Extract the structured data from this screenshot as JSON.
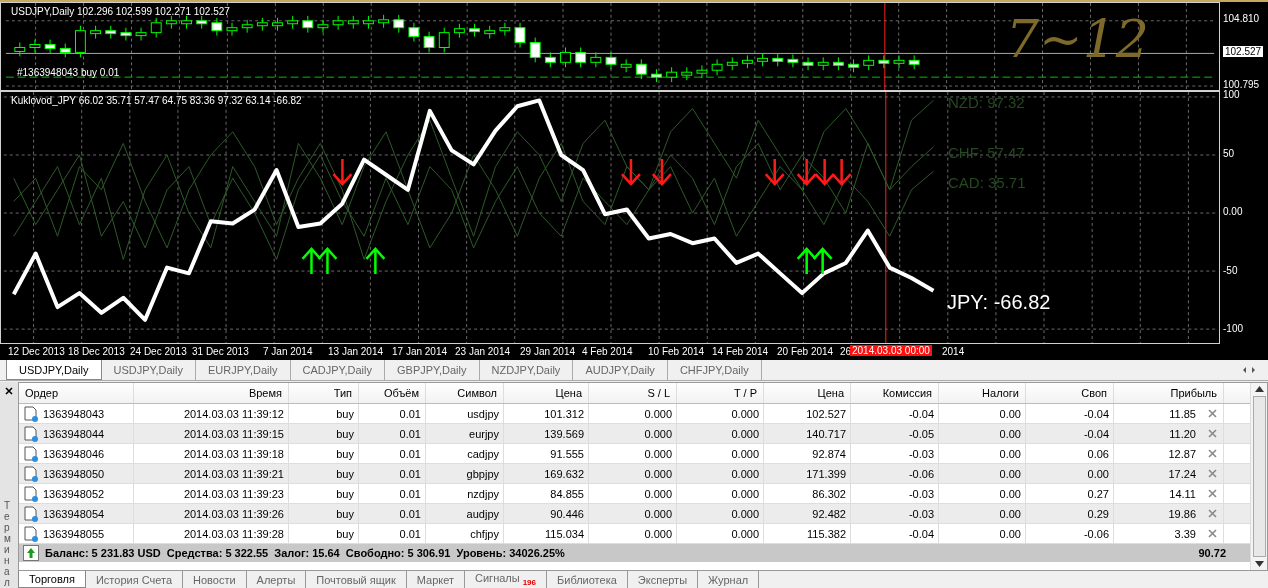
{
  "price_chart": {
    "header": "USDJPY,Daily  102.296 102.599 102.271 102.527",
    "order_line": "#1363948043 buy 0.01",
    "handwriting": "7~12",
    "axis": [
      {
        "label": "104.810",
        "kind": "tick"
      },
      {
        "label": "102.527",
        "kind": "current"
      },
      {
        "label": "100.795",
        "kind": "tick"
      }
    ]
  },
  "indicator": {
    "header": "Kuklovod_JPY 66.02 35.71 57.47 64.75 83.36 97.32 63.14 -66.82",
    "chart_data": {
      "type": "line",
      "grid": true,
      "ylim": [
        -100,
        100
      ],
      "yticks": [
        {
          "value": 100,
          "label": "100"
        },
        {
          "value": 50,
          "label": "50"
        },
        {
          "value": 0,
          "label": "0.00"
        },
        {
          "value": -50,
          "label": "-50"
        },
        {
          "value": -100,
          "label": "-100"
        }
      ],
      "series": [
        {
          "name": "NZD: 97.32",
          "color": "#2f5a2a",
          "values": [
            10,
            30,
            -20,
            40,
            20,
            60,
            10,
            -30,
            20,
            50,
            70,
            40,
            -10,
            30,
            60,
            20,
            -40,
            10,
            50,
            80,
            30,
            -20,
            40,
            70,
            50,
            10,
            60,
            80,
            40,
            20,
            70,
            90,
            60,
            30,
            80,
            50,
            20,
            70,
            90,
            60,
            20,
            80,
            97
          ]
        },
        {
          "name": "CHF: 57.47",
          "color": "#2f5a2a",
          "values": [
            -20,
            10,
            40,
            -10,
            30,
            -40,
            20,
            50,
            0,
            -30,
            40,
            10,
            -20,
            60,
            30,
            -10,
            40,
            70,
            20,
            -30,
            0,
            50,
            20,
            -20,
            30,
            60,
            10,
            -10,
            40,
            20,
            50,
            30,
            -10,
            40,
            60,
            20,
            50,
            30,
            0,
            60,
            20,
            40,
            57
          ]
        },
        {
          "name": "CAD: 35.71",
          "color": "#2f5a2a",
          "values": [
            30,
            -10,
            20,
            50,
            -20,
            10,
            -30,
            20,
            40,
            -10,
            30,
            0,
            -40,
            20,
            50,
            10,
            -20,
            30,
            -10,
            40,
            20,
            -30,
            10,
            40,
            0,
            -20,
            30,
            10,
            -10,
            20,
            40,
            0,
            30,
            -20,
            10,
            40,
            20,
            -10,
            30,
            10,
            -20,
            20,
            36
          ]
        },
        {
          "name": "JPY: -66.82",
          "color": "#ffffff",
          "values": [
            -70,
            -35,
            -81,
            -69,
            -86,
            -73,
            -92,
            -47,
            -52,
            -7,
            -9,
            3,
            37,
            -12,
            -9,
            8,
            46,
            33,
            20,
            88,
            54,
            42,
            71,
            92,
            97,
            50,
            37,
            -1,
            3,
            -22,
            -18,
            -26,
            -22,
            -43,
            -35,
            -52,
            -69,
            -52,
            -43,
            -15,
            -47,
            -56,
            -67
          ]
        }
      ]
    }
  },
  "time_axis": {
    "labels": [
      "12 Dec 2013",
      "18 Dec 2013",
      "24 Dec 2013",
      "31 Dec 2013",
      "7 Jan 2014",
      "13 Jan 2014",
      "17 Jan 2014",
      "23 Jan 2014",
      "29 Jan 2014",
      "4 Feb 2014",
      "10 Feb 2014",
      "14 Feb 2014",
      "20 Feb 2014",
      "26"
    ],
    "cursor": "2014.03.03 00:00",
    "after_cursor": "2014"
  },
  "chart_tabs": [
    {
      "label": "USDJPY,Daily",
      "selected": true
    },
    {
      "label": "USDJPY,Daily",
      "selected": false
    },
    {
      "label": "EURJPY,Daily",
      "selected": false
    },
    {
      "label": "CADJPY,Daily",
      "selected": false
    },
    {
      "label": "GBPJPY,Daily",
      "selected": false
    },
    {
      "label": "NZDJPY,Daily",
      "selected": false
    },
    {
      "label": "AUDJPY,Daily",
      "selected": false
    },
    {
      "label": "CHFJPY,Daily",
      "selected": false
    }
  ],
  "terminal": {
    "side_label": "Терминал",
    "columns": [
      "Ордер",
      "Время",
      "Тип",
      "Объём",
      "Символ",
      "Цена",
      "S / L",
      "T / P",
      "Цена",
      "Комиссия",
      "Налоги",
      "Своп",
      "Прибыль"
    ],
    "rows": [
      [
        "1363948043",
        "2014.03.03 11:39:12",
        "buy",
        "0.01",
        "usdjpy",
        "101.312",
        "0.000",
        "0.000",
        "102.527",
        "-0.04",
        "0.00",
        "-0.04",
        "11.85"
      ],
      [
        "1363948044",
        "2014.03.03 11:39:15",
        "buy",
        "0.01",
        "eurjpy",
        "139.569",
        "0.000",
        "0.000",
        "140.717",
        "-0.05",
        "0.00",
        "-0.04",
        "11.20"
      ],
      [
        "1363948046",
        "2014.03.03 11:39:18",
        "buy",
        "0.01",
        "cadjpy",
        "91.555",
        "0.000",
        "0.000",
        "92.874",
        "-0.03",
        "0.00",
        "0.06",
        "12.87"
      ],
      [
        "1363948050",
        "2014.03.03 11:39:21",
        "buy",
        "0.01",
        "gbpjpy",
        "169.632",
        "0.000",
        "0.000",
        "171.399",
        "-0.06",
        "0.00",
        "0.00",
        "17.24"
      ],
      [
        "1363948052",
        "2014.03.03 11:39:23",
        "buy",
        "0.01",
        "nzdjpy",
        "84.855",
        "0.000",
        "0.000",
        "86.302",
        "-0.03",
        "0.00",
        "0.27",
        "14.11"
      ],
      [
        "1363948054",
        "2014.03.03 11:39:26",
        "buy",
        "0.01",
        "audjpy",
        "90.446",
        "0.000",
        "0.000",
        "92.482",
        "-0.03",
        "0.00",
        "0.29",
        "19.86"
      ],
      [
        "1363948055",
        "2014.03.03 11:39:28",
        "buy",
        "0.01",
        "chfjpy",
        "115.034",
        "0.000",
        "0.000",
        "115.382",
        "-0.04",
        "0.00",
        "-0.06",
        "3.39"
      ]
    ],
    "summary": "Баланс: 5 231.83 USD  Средства: 5 322.55  Залог: 15.64  Свободно: 5 306.91  Уровень: 34026.25%",
    "total": "90.72",
    "tabs": [
      {
        "label": "Торговля",
        "selected": true
      },
      {
        "label": "История Счета",
        "selected": false
      },
      {
        "label": "Новости",
        "selected": false
      },
      {
        "label": "Алерты",
        "selected": false
      },
      {
        "label": "Почтовый ящик",
        "selected": false
      },
      {
        "label": "Маркет",
        "selected": false
      },
      {
        "label": "Сигналы",
        "badge": "196",
        "selected": false
      },
      {
        "label": "Библиотека",
        "selected": false
      },
      {
        "label": "Эксперты",
        "selected": false
      },
      {
        "label": "Журнал",
        "selected": false
      }
    ]
  }
}
